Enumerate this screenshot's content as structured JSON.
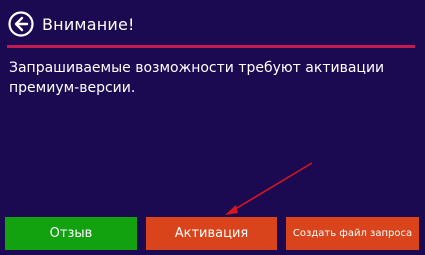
{
  "header": {
    "title": "Внимание!",
    "back_icon": "arrow-left-circle-icon"
  },
  "message": {
    "text": "Запрашиваемые возможности требуют активации премиум-версии."
  },
  "buttons": {
    "feedback": "Отзыв",
    "activate": "Активация",
    "create_request": "Создать файл запроса"
  },
  "colors": {
    "background": "#1b0a52",
    "divider": "#c41a52",
    "feedback_button": "#12a10f",
    "action_button": "#d9441c",
    "annotation_arrow": "#d7161e"
  }
}
